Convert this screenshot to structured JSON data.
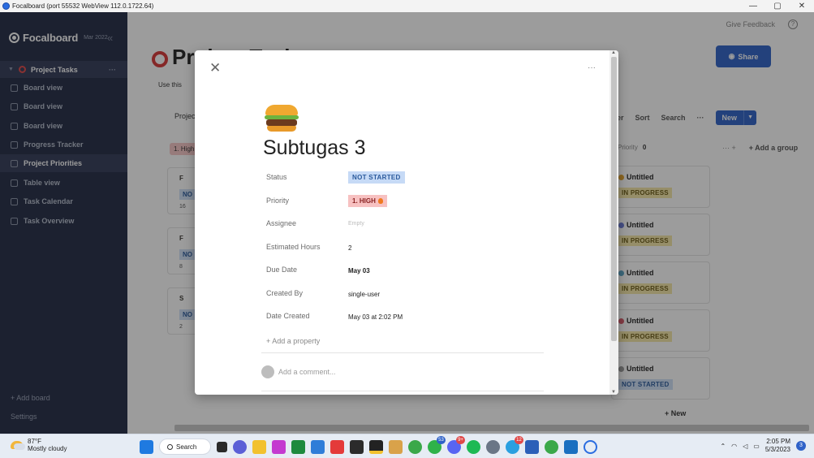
{
  "window": {
    "title": "Focalboard (port 55532 WebView 112.0.1722.64)",
    "controls": [
      "—",
      "▢",
      "✕"
    ]
  },
  "sidebar": {
    "brand": "Focalboard",
    "version": "Mar 2022",
    "board": "Project Tasks",
    "items": [
      {
        "label": "Board view",
        "active": false
      },
      {
        "label": "Board view",
        "active": false
      },
      {
        "label": "Board view",
        "active": false
      },
      {
        "label": "Progress Tracker",
        "active": false
      },
      {
        "label": "Project Priorities",
        "active": true
      },
      {
        "label": "Table view",
        "active": false
      },
      {
        "label": "Task Calendar",
        "active": false
      },
      {
        "label": "Task Overview",
        "active": false
      }
    ],
    "add_board": "+ Add board",
    "settings": "Settings"
  },
  "board": {
    "give_feedback": "Give Feedback",
    "share": "Share",
    "title": "Project Tasks",
    "description": "Use this",
    "view_label": "Projec",
    "toolbar": {
      "filter": "ter",
      "sort": "Sort",
      "search": "Search",
      "more": "···",
      "new": "New"
    },
    "group_tag": "1. High",
    "right_group": {
      "name": "Priority",
      "count": "0"
    },
    "add_group": "+ Add a group",
    "left_cards": [
      {
        "title": "F",
        "badge": "NO",
        "num": "16"
      },
      {
        "title": "F",
        "badge": "NO",
        "num": "8"
      },
      {
        "title": "S",
        "badge": "NO",
        "num": "2"
      }
    ],
    "right_cards": [
      {
        "title": "Untitled",
        "status": "IN PROGRESS"
      },
      {
        "title": "Untitled",
        "status": "IN PROGRESS"
      },
      {
        "title": "Untitled",
        "status": "IN PROGRESS"
      },
      {
        "title": "Untitled",
        "status": "IN PROGRESS"
      },
      {
        "title": "Untitled",
        "status": "NOT STARTED"
      }
    ],
    "new_card": "+ New"
  },
  "card": {
    "more": "···",
    "title": "Subtugas 3",
    "icon": "burger-emoji",
    "properties": {
      "status_label": "Status",
      "status": "NOT STARTED",
      "priority_label": "Priority",
      "priority": "1. HIGH",
      "assignee_label": "Assignee",
      "assignee": "Empty",
      "hours_label": "Estimated Hours",
      "hours": "2",
      "due_label": "Due Date",
      "due": "May 03",
      "created_by_label": "Created By",
      "created_by": "single-user",
      "date_created_label": "Date Created",
      "date_created": "May 03 at 2:02 PM"
    },
    "add_property": "+ Add a property",
    "comment_placeholder": "Add a comment..."
  },
  "taskbar": {
    "temp": "87°F",
    "weather": "Mostly cloudy",
    "search": "Search",
    "badges": {
      "whatsapp": "53",
      "discord": "9+",
      "telegram": "12"
    },
    "time": "2:05 PM",
    "date": "5/3/2023",
    "notifications": "3"
  },
  "colors": {
    "sidebar": "#242c45",
    "accent": "#2f62c8",
    "not_started": "#c6daf6",
    "in_progress": "#f4e7a7",
    "high": "#f7c1c1"
  }
}
